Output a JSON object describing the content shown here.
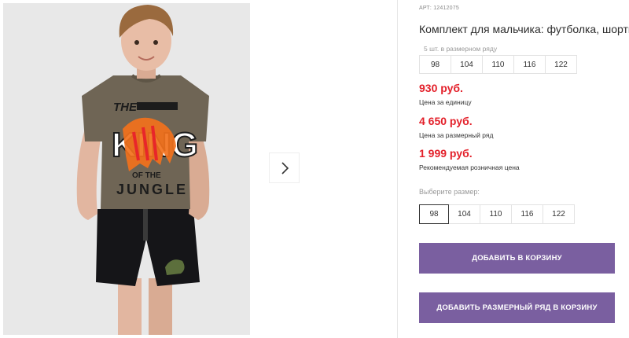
{
  "product": {
    "sku": "АРТ: 12412075",
    "title": "Комплект для мальчика: футболка, шорты",
    "pack_label": "5 шт. в размерном ряду",
    "pack_sizes": [
      "98",
      "104",
      "110",
      "116",
      "122"
    ]
  },
  "prices": {
    "unit": {
      "value": "930 руб.",
      "note": "Цена за единицу"
    },
    "pack": {
      "value": "4 650 руб.",
      "note": "Цена за размерный ряд"
    },
    "retail": {
      "value": "1 999 руб.",
      "note": "Рекомендуемая розничная цена"
    }
  },
  "size_select": {
    "label": "Выберите размер:",
    "options": [
      "98",
      "104",
      "110",
      "116",
      "122"
    ],
    "selected": "98"
  },
  "buttons": {
    "add_to_cart": "ДОБАВИТЬ В КОРЗИНУ",
    "add_pack_to_cart": "ДОБАВИТЬ РАЗМЕРНЫЙ РЯД В КОРЗИНУ"
  },
  "gallery": {
    "next_icon": "chevron-right-icon",
    "shirt_print": [
      "THE",
      "KING",
      "OF THE",
      "JUNGLE"
    ]
  },
  "colors": {
    "price": "#e3202a",
    "button": "#7a5fa0",
    "photo_bg": "#e7e7e7"
  }
}
